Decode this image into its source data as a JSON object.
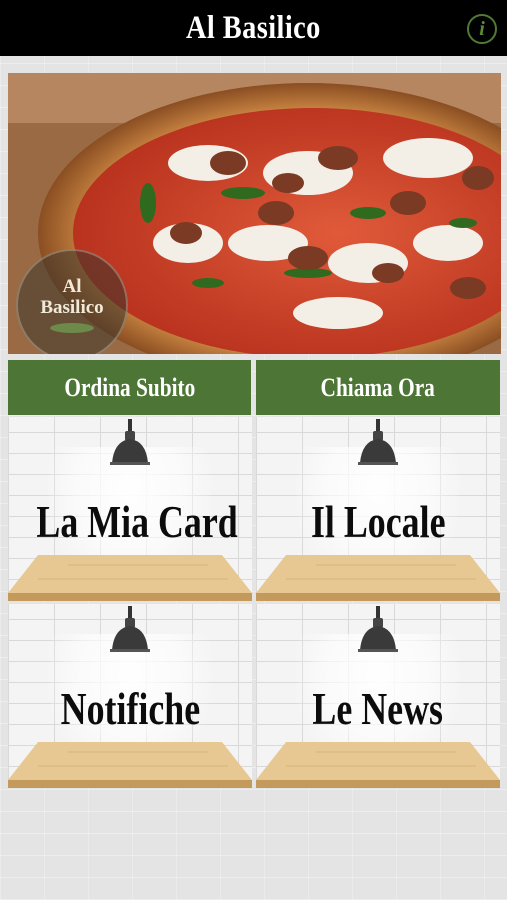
{
  "header": {
    "title": "Al Basilico",
    "info_label": "i"
  },
  "hero": {
    "logo_line1": "Al",
    "logo_line2": "Basilico"
  },
  "actions": [
    {
      "label": "Ordina Subito"
    },
    {
      "label": "Chiama Ora"
    }
  ],
  "tiles": [
    {
      "label": "La Mia Card"
    },
    {
      "label": "Il Locale"
    },
    {
      "label": "Notifiche"
    },
    {
      "label": "Le News"
    }
  ],
  "colors": {
    "header_bg": "#000000",
    "accent_green": "#4d7535",
    "info_icon": "#5e8a3e"
  }
}
